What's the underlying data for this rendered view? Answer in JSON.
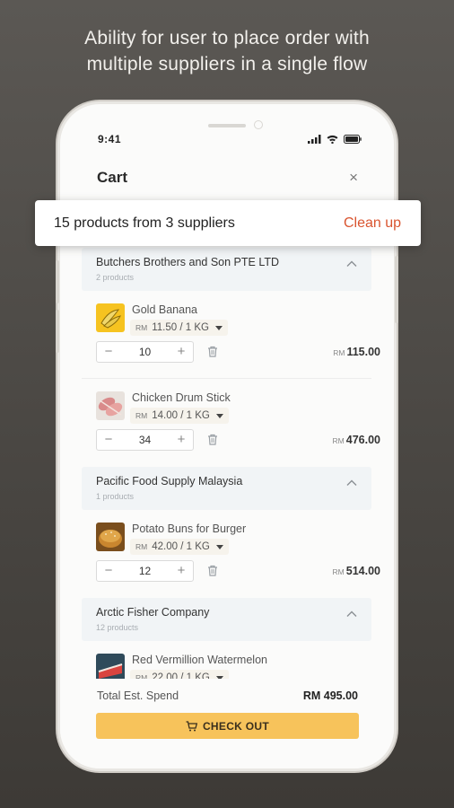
{
  "headline": {
    "line1": "Ability for user to place order with",
    "line2": "multiple suppliers in a single flow"
  },
  "status": {
    "time": "9:41"
  },
  "cart": {
    "title": "Cart",
    "close_label": "×"
  },
  "summary": {
    "text": "15 products from 3 suppliers",
    "cleanup_label": "Clean up"
  },
  "suppliers": [
    {
      "name": "Butchers Brothers and Son PTE LTD",
      "count": "2 products",
      "products": [
        {
          "name": "Gold Banana",
          "currency": "RM",
          "price": "11.50 / 1 KG",
          "qty": "10",
          "total_currency": "RM",
          "total": "115.00"
        },
        {
          "name": "Chicken Drum Stick",
          "currency": "RM",
          "price": "14.00 / 1 KG",
          "qty": "34",
          "total_currency": "RM",
          "total": "476.00"
        }
      ]
    },
    {
      "name": "Pacific Food Supply Malaysia",
      "count": "1 products",
      "products": [
        {
          "name": "Potato Buns for Burger",
          "currency": "RM",
          "price": "42.00 / 1 KG",
          "qty": "12",
          "total_currency": "RM",
          "total": "514.00"
        }
      ]
    },
    {
      "name": "Arctic Fisher Company",
      "count": "12 products",
      "products": [
        {
          "name": "Red Vermillion Watermelon",
          "currency": "RM",
          "price": "22.00 / 1 KG"
        }
      ]
    }
  ],
  "footer": {
    "total_label": "Total Est. Spend",
    "total_value": "RM 495.00",
    "checkout_label": "CHECK OUT"
  },
  "colors": {
    "accent": "#f7c35b",
    "cleanup": "#d9542f",
    "supplier_bg": "#f1f4f6"
  },
  "icons": [
    "signal-icon",
    "wifi-icon",
    "battery-icon",
    "close-icon",
    "chevron-up-icon",
    "minus-icon",
    "plus-icon",
    "trash-icon",
    "drag-handle-icon",
    "cart-icon"
  ]
}
